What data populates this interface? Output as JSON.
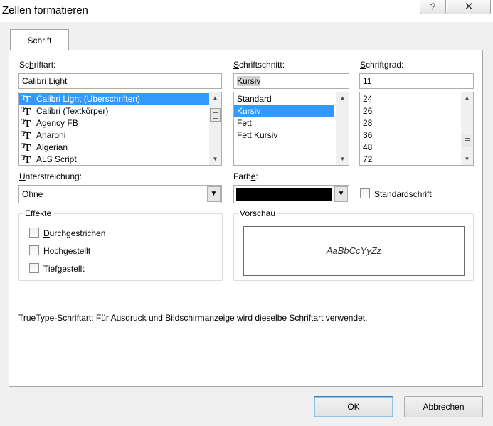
{
  "window": {
    "title": "Zellen formatieren",
    "help_glyph": "?",
    "close_glyph": "✕"
  },
  "tabs": [
    {
      "label": "Schrift",
      "active": true
    }
  ],
  "font": {
    "label_pre": "Sc",
    "label_acc": "h",
    "label_post": "riftart:",
    "value": "Calibri Light",
    "items": [
      {
        "label": "Calibri Light (Überschriften)",
        "selected": true
      },
      {
        "label": "Calibri (Textkörper)",
        "selected": false
      },
      {
        "label": "Agency FB",
        "selected": false
      },
      {
        "label": "Aharoni",
        "selected": false
      },
      {
        "label": "Algerian",
        "selected": false
      },
      {
        "label": "ALS Script",
        "selected": false
      }
    ],
    "icon": "truetype-icon"
  },
  "style": {
    "label_pre": "",
    "label_acc": "S",
    "label_post": "chriftschnitt:",
    "value": "Kursiv",
    "items": [
      {
        "label": "Standard",
        "selected": false
      },
      {
        "label": "Kursiv",
        "selected": true
      },
      {
        "label": "Fett",
        "selected": false
      },
      {
        "label": "Fett Kursiv",
        "selected": false
      }
    ]
  },
  "size": {
    "label_pre": "",
    "label_acc": "S",
    "label_post": "chriftgrad:",
    "value": "11",
    "items": [
      "24",
      "26",
      "28",
      "36",
      "48",
      "72"
    ]
  },
  "underline": {
    "label_pre": "",
    "label_acc": "U",
    "label_post": "nterstreichung:",
    "value": "Ohne"
  },
  "color": {
    "label_pre": "Farb",
    "label_acc": "e",
    "label_post": ":",
    "value_hex": "#000000"
  },
  "standard_font": {
    "label_pre": "St",
    "label_acc": "a",
    "label_post": "ndardschrift",
    "checked": false
  },
  "effects": {
    "title": "Effekte",
    "items": [
      {
        "pre": "",
        "acc": "D",
        "post": "urchgestrichen",
        "checked": false
      },
      {
        "pre": "",
        "acc": "H",
        "post": "ochgestellt",
        "checked": false
      },
      {
        "pre": "Tief",
        "acc": "g",
        "post": "estellt",
        "checked": false
      }
    ]
  },
  "preview": {
    "title": "Vorschau",
    "sample": "AaBbCcYyZz"
  },
  "info_text": "TrueType-Schriftart: Für Ausdruck und Bildschirmanzeige wird dieselbe Schriftart verwendet.",
  "buttons": {
    "ok": "OK",
    "cancel": "Abbrechen"
  },
  "colors": {
    "selection": "#3399ff",
    "dialog_bg": "#f0f0f0",
    "panel_bg": "#ffffff"
  }
}
